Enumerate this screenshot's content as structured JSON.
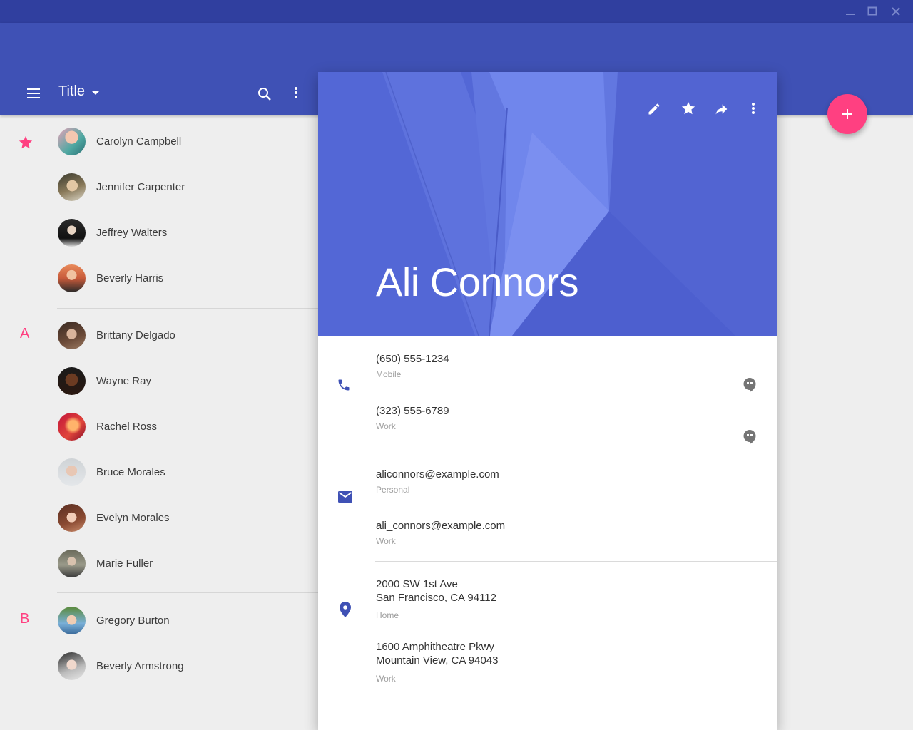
{
  "window": {
    "minimize_icon": "minimize-icon",
    "maximize_icon": "maximize-icon",
    "close_icon": "close-icon"
  },
  "appbar": {
    "title": "Title",
    "menu_icon": "menu-icon",
    "dropdown_icon": "arrow-drop-down-icon",
    "search_icon": "search-icon",
    "more_icon": "more-vert-icon",
    "color": "#3f51b5"
  },
  "contacts": {
    "starred": [
      {
        "name": "Carolyn Campbell"
      },
      {
        "name": "Jennifer Carpenter"
      },
      {
        "name": "Jeffrey Walters"
      },
      {
        "name": "Beverly Harris"
      }
    ],
    "section_a_label": "A",
    "section_a": [
      {
        "name": "Brittany Delgado"
      },
      {
        "name": "Wayne Ray"
      },
      {
        "name": "Rachel Ross"
      },
      {
        "name": "Bruce Morales"
      },
      {
        "name": "Evelyn Morales"
      },
      {
        "name": "Marie Fuller"
      }
    ],
    "section_b_label": "B",
    "section_b": [
      {
        "name": "Gregory Burton"
      },
      {
        "name": "Beverly Armstrong"
      }
    ]
  },
  "detail": {
    "name": "Ali Connors",
    "toolbar_icons": [
      "edit-icon",
      "star-icon",
      "share-icon",
      "more-vert-icon"
    ],
    "phones": [
      {
        "number": "(650) 555-1234",
        "type": "Mobile"
      },
      {
        "number": "(323) 555-6789",
        "type": "Work"
      }
    ],
    "emails": [
      {
        "address": "aliconnors@example.com",
        "type": "Personal"
      },
      {
        "address": "ali_connors@example.com",
        "type": "Work"
      }
    ],
    "addresses": [
      {
        "line1": "2000 SW 1st Ave",
        "line2": "San Francisco, CA 94112",
        "type": "Home"
      },
      {
        "line1": "1600 Amphitheatre Pkwy",
        "line2": "Mountain View, CA 94043",
        "type": "Work"
      }
    ]
  },
  "fab": {
    "icon": "add-icon",
    "color": "#ff4081"
  },
  "accent_color": "#ff4081"
}
